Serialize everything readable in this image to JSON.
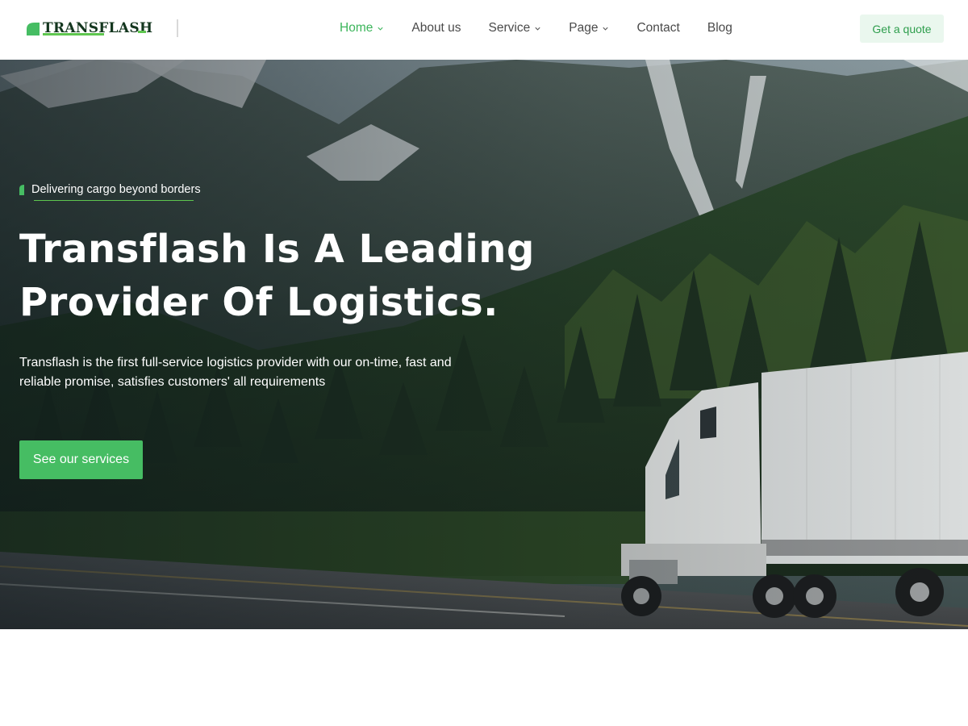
{
  "brand": {
    "name": "TRANSFLASH",
    "accent_color": "#46bd63",
    "dark_color": "#13361e",
    "logo_icon": "leaf-mark-icon"
  },
  "nav": {
    "items": [
      {
        "label": "Home",
        "active": true,
        "has_dropdown": true
      },
      {
        "label": "About us",
        "active": false,
        "has_dropdown": false
      },
      {
        "label": "Service",
        "active": false,
        "has_dropdown": true
      },
      {
        "label": "Page",
        "active": false,
        "has_dropdown": true
      },
      {
        "label": "Contact",
        "active": false,
        "has_dropdown": false
      },
      {
        "label": "Blog",
        "active": false,
        "has_dropdown": false
      }
    ],
    "quote_button": "Get a quote"
  },
  "hero": {
    "tagline": "Delivering cargo beyond borders",
    "title_line1": "Transflash Is A Leading",
    "title_line2": "Provider Of Logistics.",
    "description": "Transflash is the first full-service logistics provider with our on-time, fast and reliable promise, satisfies customers' all requirements",
    "cta": "See our services"
  }
}
